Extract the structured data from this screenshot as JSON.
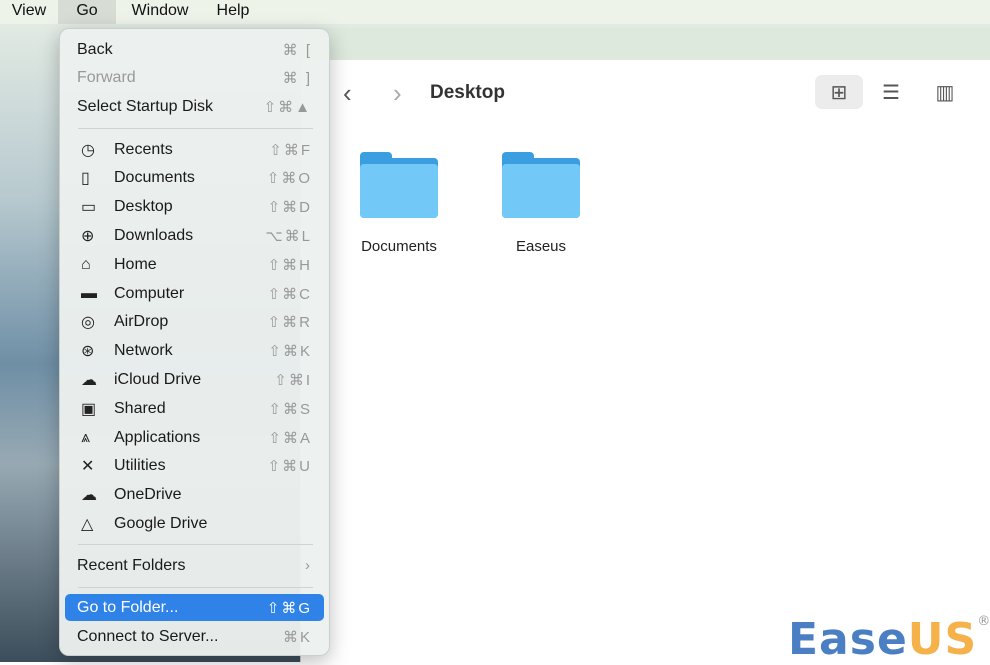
{
  "menubar": [
    "View",
    "Go",
    "Window",
    "Help"
  ],
  "finder": {
    "title": "Desktop",
    "folders": [
      "Documents",
      "Easeus"
    ]
  },
  "menu": {
    "top": [
      {
        "label": "Back",
        "shortcut": "⌘ ["
      },
      {
        "label": "Forward",
        "shortcut": "⌘ ]",
        "disabled": true
      },
      {
        "label": "Select Startup Disk",
        "shortcut": "⇧⌘▲"
      }
    ],
    "places": [
      {
        "icon": "clock-icon",
        "glyph": "◷",
        "label": "Recents",
        "shortcut": "⇧⌘F"
      },
      {
        "icon": "document-icon",
        "glyph": "▯",
        "label": "Documents",
        "shortcut": "⇧⌘O"
      },
      {
        "icon": "desktop-icon",
        "glyph": "▭",
        "label": "Desktop",
        "shortcut": "⇧⌘D"
      },
      {
        "icon": "download-icon",
        "glyph": "⊕",
        "label": "Downloads",
        "shortcut": "⌥⌘L"
      },
      {
        "icon": "home-icon",
        "glyph": "⌂",
        "label": "Home",
        "shortcut": "⇧⌘H"
      },
      {
        "icon": "laptop-icon",
        "glyph": "▬",
        "label": "Computer",
        "shortcut": "⇧⌘C"
      },
      {
        "icon": "airdrop-icon",
        "glyph": "◎",
        "label": "AirDrop",
        "shortcut": "⇧⌘R"
      },
      {
        "icon": "globe-icon",
        "glyph": "⊛",
        "label": "Network",
        "shortcut": "⇧⌘K"
      },
      {
        "icon": "cloud-icon",
        "glyph": "☁",
        "label": "iCloud Drive",
        "shortcut": "⇧⌘I"
      },
      {
        "icon": "shared-folder-icon",
        "glyph": "▣",
        "label": "Shared",
        "shortcut": "⇧⌘S"
      },
      {
        "icon": "applications-icon",
        "glyph": "⩓",
        "label": "Applications",
        "shortcut": "⇧⌘A"
      },
      {
        "icon": "utilities-icon",
        "glyph": "✕",
        "label": "Utilities",
        "shortcut": "⇧⌘U"
      },
      {
        "icon": "cloud-icon",
        "glyph": "☁",
        "label": "OneDrive",
        "shortcut": ""
      },
      {
        "icon": "google-drive-icon",
        "glyph": "△",
        "label": "Google Drive",
        "shortcut": ""
      }
    ],
    "recent_folders": "Recent Folders",
    "recent_arrow": "›",
    "go_to_folder": {
      "label": "Go to Folder...",
      "shortcut": "⇧⌘G"
    },
    "connect": {
      "label": "Connect to Server...",
      "shortcut": "⌘K"
    }
  },
  "logo": {
    "a": "Ease",
    "b": "US",
    "mark": "®"
  },
  "colors": {
    "highlight": "#2f82e8",
    "folder": "#72c9f8"
  }
}
